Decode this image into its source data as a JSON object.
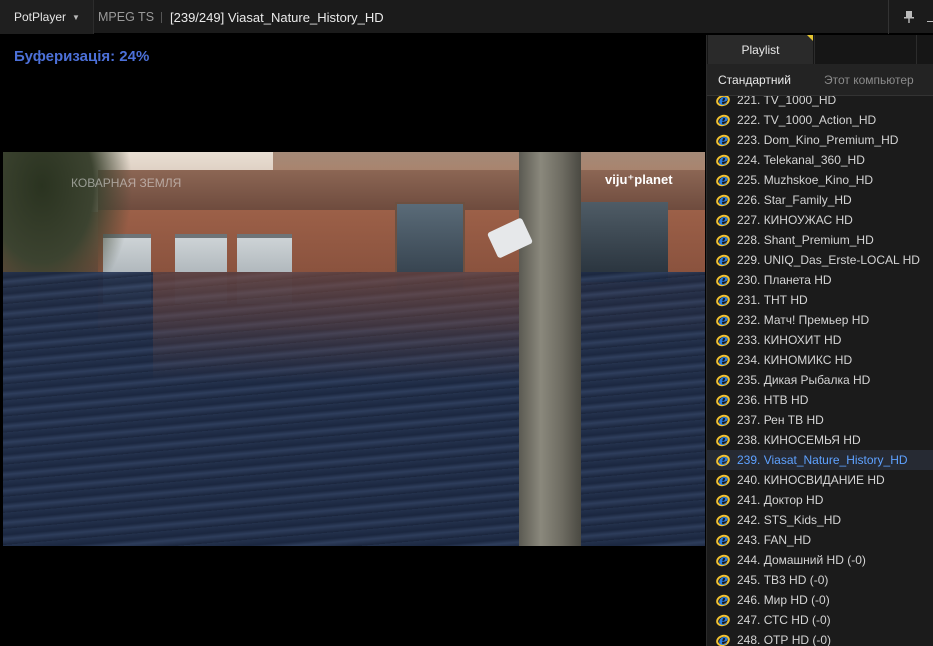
{
  "titlebar": {
    "app_name": "PotPlayer",
    "format": "MPEG TS",
    "title": "[239/249] Viasat_Nature_History_HD",
    "icons": [
      "pin-icon",
      "minimize-icon"
    ]
  },
  "video": {
    "buffering_text": "Буферизація: 24%",
    "watermark_left": "КОВАРНАЯ ЗЕМЛЯ",
    "watermark_right": "viju⁺planet"
  },
  "playlist": {
    "tab_label": "Playlist",
    "subtabs": [
      "Стандартний",
      "Этот компьютер"
    ],
    "items": [
      "221. TV_1000_HD",
      "222. TV_1000_Action_HD",
      "223. Dom_Kino_Premium_HD",
      "224. Telekanal_360_HD",
      "225. Muzhskoe_Kino_HD",
      "226. Star_Family_HD",
      "227. КИНОУЖАС HD",
      "228. Shant_Premium_HD",
      "229. UNIQ_Das_Erste-LOCAL HD",
      "230. Планета HD",
      "231. ТНТ HD",
      "232. Матч! Премьер HD",
      "233. КИНОХИТ HD",
      "234. КИНОМИКС HD",
      "235. Дикая Рыбалка HD",
      "236. НТВ HD",
      "237. Рен ТВ HD",
      "238. КИНОСЕМЬЯ HD",
      "239. Viasat_Nature_History_HD",
      "240. КИНОСВИДАНИЕ HD",
      "241. Доктор HD",
      "242. STS_Kids_HD",
      "243. FAN_HD",
      "244. Домашний HD (-0)",
      "245. ТВ3 HD (-0)",
      "246. Мир HD (-0)",
      "247. СТС HD (-0)",
      "248. ОТР HD (-0)"
    ],
    "active_index": 18,
    "item_icon": "internet-explorer-icon"
  },
  "colors": {
    "buffer_text": "#4c70d8",
    "active_item": "#5ea1ff",
    "tab_marker": "#e5c531"
  }
}
